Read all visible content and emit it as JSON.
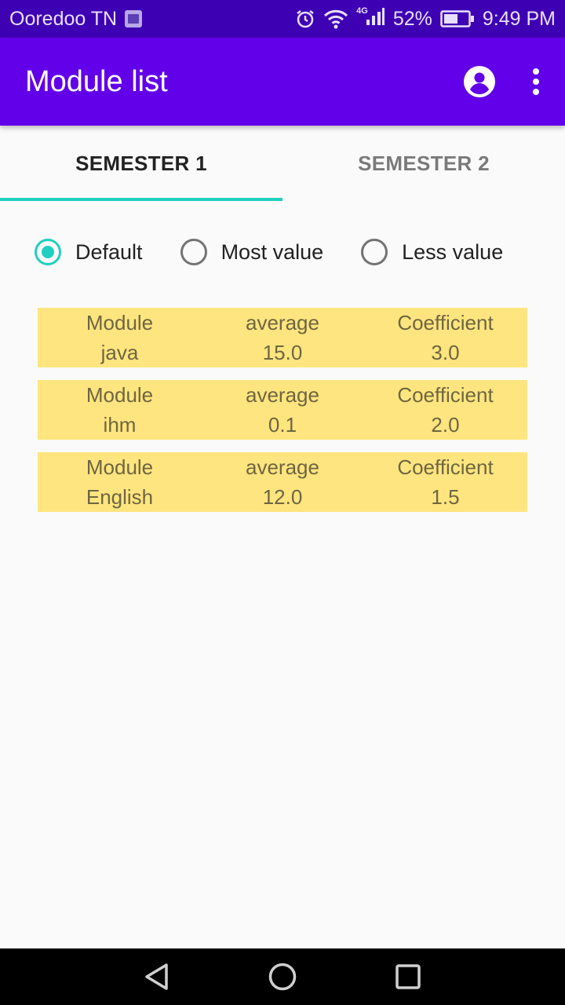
{
  "status_bar": {
    "carrier": "Ooredoo TN",
    "network": "4G",
    "battery": "52%",
    "time": "9:49 PM",
    "icons": [
      "gallery-icon",
      "alarm-icon",
      "wifi-icon",
      "signal-icon",
      "battery-icon"
    ]
  },
  "app_bar": {
    "title": "Module list",
    "actions": [
      "account-circle-icon",
      "more-vert-icon"
    ],
    "background": "#6200ea"
  },
  "tabs": [
    {
      "label": "SEMESTER 1",
      "selected": true
    },
    {
      "label": "SEMESTER 2",
      "selected": false
    }
  ],
  "sort_options": [
    {
      "label": "Default",
      "checked": true
    },
    {
      "label": "Most value",
      "checked": false
    },
    {
      "label": "Less value",
      "checked": false
    }
  ],
  "headers": {
    "module": "Module",
    "average": "average",
    "coefficient": "Coefficient"
  },
  "modules": [
    {
      "name": "java",
      "average": "15.0",
      "coefficient": "3.0"
    },
    {
      "name": "ihm",
      "average": "0.1",
      "coefficient": "2.0"
    },
    {
      "name": "English",
      "average": "12.0",
      "coefficient": "1.5"
    }
  ],
  "colors": {
    "accent": "#1fd0c0",
    "card": "#ffe57f",
    "status_bar": "#3e00b3"
  },
  "nav_bar": [
    "back-icon",
    "home-icon",
    "recents-icon"
  ]
}
